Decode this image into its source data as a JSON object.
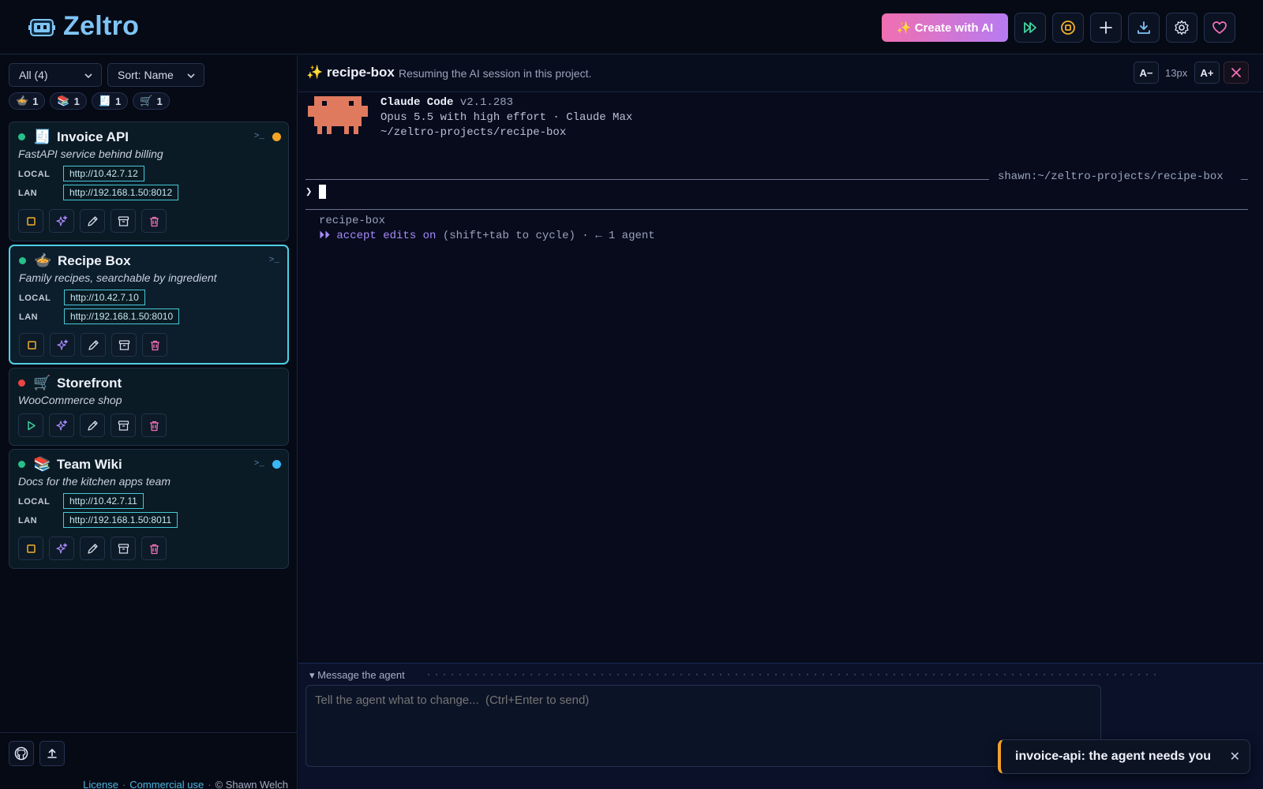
{
  "header": {
    "title": "Zeltro",
    "logo_icon": "robot-icon",
    "create_ai_label": "✨ Create with AI",
    "buttons": [
      "fast-forward-icon",
      "stop-circle-icon",
      "plus-icon",
      "download-icon",
      "gear-icon",
      "heart-icon"
    ]
  },
  "sidebar": {
    "filter_value": "All (4)",
    "sort_value": "Sort: Name",
    "chips": [
      {
        "emoji": "🍲",
        "count": "1"
      },
      {
        "emoji": "📚",
        "count": "1"
      },
      {
        "emoji": "🧾",
        "count": "1"
      },
      {
        "emoji": "🛒",
        "count": "1"
      }
    ],
    "projects": [
      {
        "emoji": "🧾",
        "name": "Invoice API",
        "desc": "FastAPI service behind billing",
        "running": true,
        "status_color": "#f5a524",
        "local_label": "LOCAL",
        "local_url": "http://10.42.7.12",
        "lan_label": "LAN",
        "lan_url": "http://192.168.1.50:8012"
      },
      {
        "emoji": "🍲",
        "name": "Recipe Box",
        "desc": "Family recipes, searchable by ingredient",
        "running": true,
        "active": true,
        "local_label": "LOCAL",
        "local_url": "http://10.42.7.10",
        "lan_label": "LAN",
        "lan_url": "http://192.168.1.50:8010"
      },
      {
        "emoji": "🛒",
        "name": "Storefront",
        "desc": "WooCommerce shop",
        "running": false
      },
      {
        "emoji": "📚",
        "name": "Team Wiki",
        "desc": "Docs for the kitchen apps team",
        "running": true,
        "status_color": "#3ab7f5",
        "local_label": "LOCAL",
        "local_url": "http://10.42.7.11",
        "lan_label": "LAN",
        "lan_url": "http://192.168.1.50:8011"
      }
    ],
    "terminal_glyph": ">_",
    "footer": {
      "license": "License",
      "commercial": "Commercial use",
      "copyright": "© Shawn Welch",
      "separator": "·"
    }
  },
  "session": {
    "title": "✨ recipe-box",
    "subtitle": "Resuming the AI session in this project.",
    "font_decrease": "A−",
    "font_size": "13px",
    "font_increase": "A+"
  },
  "terminal": {
    "product": "Claude Code",
    "version": "v2.1.283",
    "model_line": "Opus 5.5 with high effort · Claude Max",
    "path_line": "~/zeltro-projects/recipe-box",
    "prompt_path": "shawn:~/zeltro-projects/recipe-box",
    "prompt_char": "❯",
    "status_project": "recipe-box",
    "status_arrows": "⏵⏵",
    "status_mode": "accept edits on",
    "status_hint": "(shift+tab to cycle) · ← 1 agent"
  },
  "composer": {
    "label": "▾ Message the agent",
    "placeholder": "Tell the agent what to change...  (Ctrl+Enter to send)"
  },
  "toast": {
    "message": "invoice-api: the agent needs you",
    "close": "✕"
  },
  "colors": {
    "accent_cyan": "#4fd0e4",
    "running": "#27c08a",
    "stopped": "#ef4444",
    "mode_purple": "#a78bfa"
  }
}
